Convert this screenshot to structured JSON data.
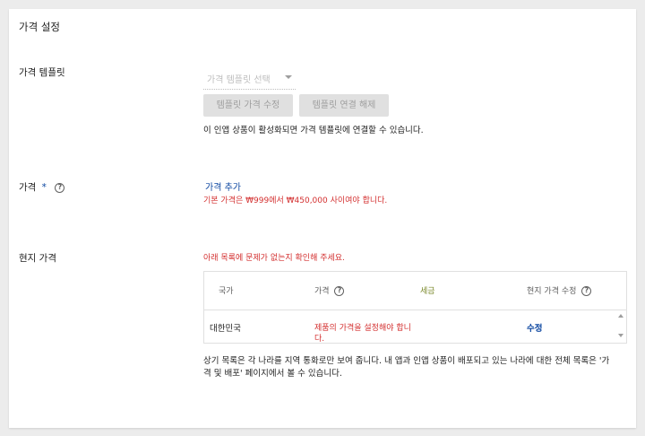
{
  "section": {
    "title": "가격 설정"
  },
  "template": {
    "label": "가격 템플릿",
    "select_placeholder": "가격 템플릿 선택",
    "edit_button": "템플릿 가격 수정",
    "unlink_button": "템플릿 연결 해제",
    "hint": "이 인앱 상품이 활성화되면 가격 템플릿에 연결할 수 있습니다."
  },
  "price": {
    "label": "가격",
    "required_mark": "*",
    "add_link": "가격 추가",
    "error": "기본 가격은 ₩999에서 ₩450,000 사이여야 합니다."
  },
  "local_price": {
    "label": "현지 가격",
    "warning": "아래 목록에 문제가 없는지 확인해 주세요.",
    "columns": {
      "country": "국가",
      "price": "가격",
      "tax": "세금",
      "local_edit": "현지 가격 수정"
    },
    "rows": [
      {
        "country": "대한민국",
        "price_error_line1": "제품의 가격을 설정해야 합니",
        "price_error_line2": "다.",
        "edit": "수정"
      }
    ],
    "footer_line1": "상기 목록은 각 나라를 지역 통화로만 보여 줍니다. 내 앱과 인앱 상품이 배포되고 있는 나라에 대한 전체 목록은 '가",
    "footer_line2": "격 및 배포' 페이지에서 볼 수 있습니다."
  },
  "icons": {
    "help": "help-circle-icon",
    "dropdown": "chevron-down-icon"
  },
  "colors": {
    "error": "#d32f2f",
    "link": "#0d47a1",
    "tax_header": "#7b8a2c"
  }
}
